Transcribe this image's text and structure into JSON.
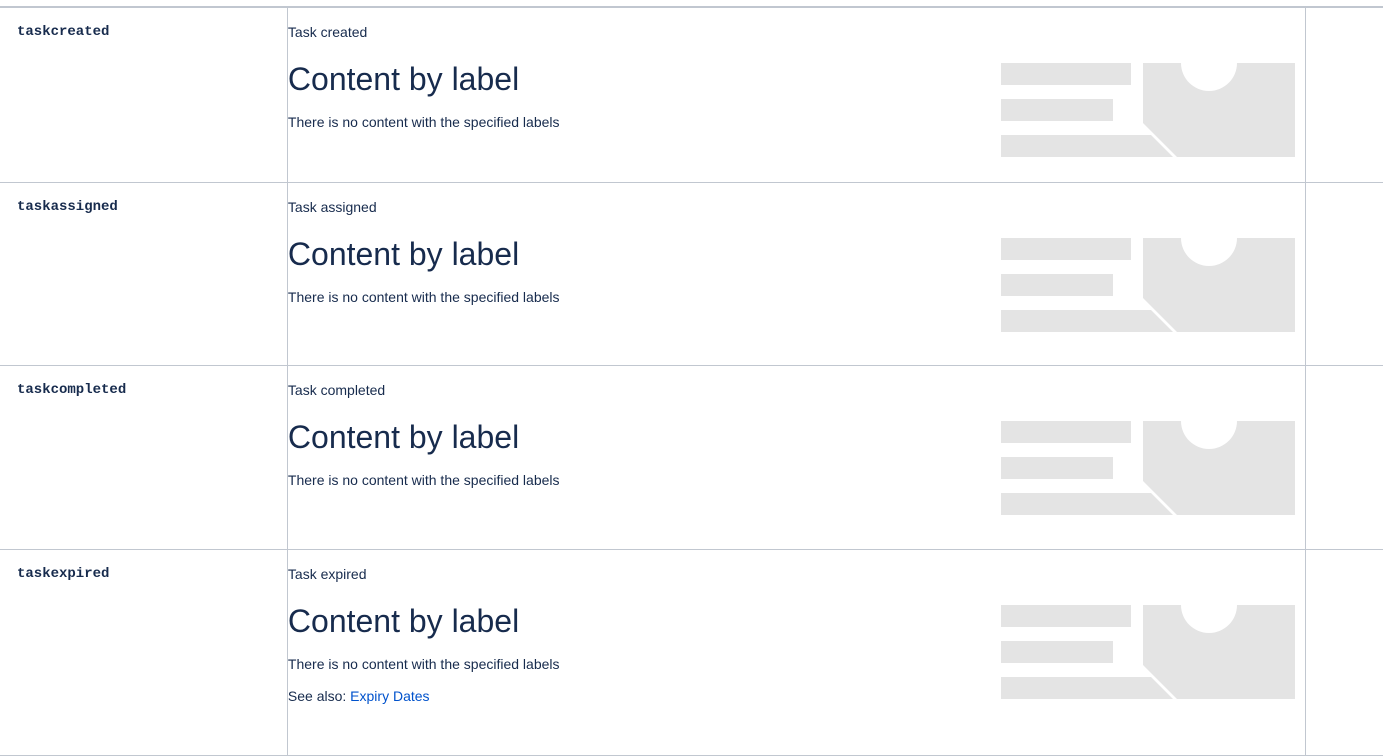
{
  "events": [
    {
      "key": "taskcreated",
      "description": "Task created",
      "macro_title": "Content by label",
      "macro_message": "There is no content with the specified labels"
    },
    {
      "key": "taskassigned",
      "description": "Task assigned",
      "macro_title": "Content by label",
      "macro_message": "There is no content with the specified labels"
    },
    {
      "key": "taskcompleted",
      "description": "Task completed",
      "macro_title": "Content by label",
      "macro_message": "There is no content with the specified labels"
    },
    {
      "key": "taskexpired",
      "description": "Task expired",
      "macro_title": "Content by label",
      "macro_message": "There is no content with the specified labels",
      "see_also_prefix": "See also: ",
      "see_also_link": "Expiry Dates"
    }
  ],
  "colors": {
    "border": "#c1c7d0",
    "text": "#172b4d",
    "link": "#0052cc",
    "placeholder": "#e4e4e4"
  },
  "icons": {
    "macro_placeholder": "content-by-label-placeholder-graphic"
  }
}
